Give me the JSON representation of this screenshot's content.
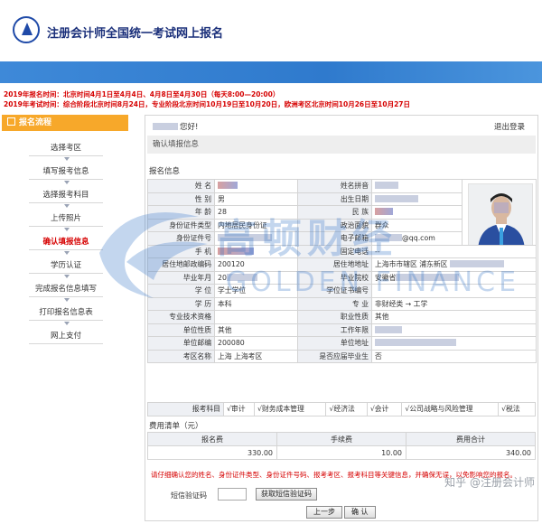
{
  "header": {
    "title": "注册会计师全国统一考试网上报名"
  },
  "notices": {
    "line1": "2019年报名时间：北京时间4月1日至4月4日、4月8日至4月30日（每天8:00—20:00）",
    "line2": "2019年考试时间：综合阶段北京时间8月24日，专业阶段北京时间10月19日至10月20日，欧洲考区北京时间10月26日至10月27日"
  },
  "sidebar": {
    "title": "报名流程",
    "steps": [
      {
        "label": "选择考区"
      },
      {
        "label": "填写报考信息"
      },
      {
        "label": "选择报考科目"
      },
      {
        "label": "上传照片"
      },
      {
        "label": "确认填报信息"
      },
      {
        "label": "学历认证"
      },
      {
        "label": "完成报名信息填写"
      },
      {
        "label": "打印报名信息表"
      },
      {
        "label": "网上支付"
      }
    ]
  },
  "main": {
    "greeting_suffix": "您好!",
    "logout": "退出登录",
    "confirm_title": "确认填报信息",
    "info_section": "报名信息",
    "fields": {
      "name_lbl": "姓 名",
      "pinyin_lbl": "姓名拼音",
      "gender_lbl": "性 别",
      "gender_val": "男",
      "birth_lbl": "出生日期",
      "age_lbl": "年 龄",
      "age_val": "28",
      "ethnicity_lbl": "民 族",
      "idtype_lbl": "身份证件类型",
      "idtype_val": "内地居民身份证",
      "political_lbl": "政治面貌",
      "political_val": "群众",
      "idno_lbl": "身份证件号",
      "email_lbl": "电子邮箱",
      "email_val": "@qq.com",
      "mobile_lbl": "手 机",
      "phone_lbl": "固定电话",
      "phone_val": "--",
      "postcode_lbl": "居住地邮政编码",
      "postcode_val": "200120",
      "address_lbl": "居住地地址",
      "address_val": "上海市市辖区  浦东新区",
      "gradyear_lbl": "毕业年月",
      "gradyear_val": "20",
      "school_lbl": "毕业院校",
      "school_val": "安徽省",
      "degree_lbl": "学 位",
      "degree_val": "学士学位",
      "degreeno_lbl": "学位证书编号",
      "edu_lbl": "学 历",
      "edu_val": "本科",
      "major_lbl": "专 业",
      "major_val": "非财经类 → 工学",
      "title_lbl": "专业技术资格",
      "jobtype_lbl": "职业性质",
      "jobtype_val": "其他",
      "unittype_lbl": "单位性质",
      "unittype_val": "其他",
      "workyears_lbl": "工作年限",
      "unitpost_lbl": "单位邮编",
      "unitpost_val": "200080",
      "unitaddr_lbl": "单位地址",
      "area_lbl": "考区名称",
      "area_val": "上海 上海考区",
      "fresh_lbl": "是否应届毕业生",
      "fresh_val": "否",
      "subjects_lbl": "报考科目"
    },
    "subjects": [
      "√审计",
      "√财务成本管理",
      "√经济法",
      "√会计",
      "√公司战略与风险管理",
      "√税法"
    ],
    "fee": {
      "title": "费用清单（元）",
      "headers": [
        "报名费",
        "手续费",
        "费用合计"
      ],
      "values": [
        "330.00",
        "10.00",
        "340.00"
      ]
    },
    "warning": "请仔细确认您的姓名、身份证件类型、身份证件号码、报考考区、报考科目等关键信息，并确保无误，以免影响您的报名。",
    "sms_label": "短信验证码",
    "sms_button": "获取短信验证码",
    "prev_button": "上一步",
    "ok_button": "确 认"
  },
  "watermark": {
    "cn": "高顿财经",
    "en": "GOLDEN FINANCE"
  },
  "zhihu": "知乎 @注册会计师",
  "colors": {
    "brand_blue": "#2f7acd",
    "sidebar_orange": "#f7a82a",
    "alert_red": "#d60000"
  }
}
